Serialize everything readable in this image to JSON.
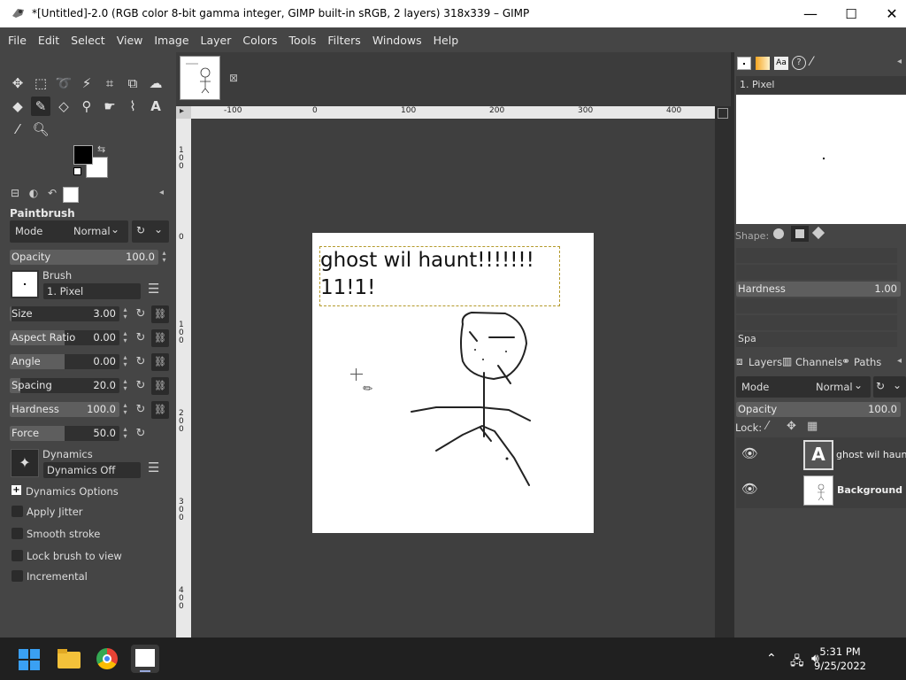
{
  "window": {
    "title": "*[Untitled]-2.0 (RGB color 8-bit gamma integer, GIMP built-in sRGB, 2 layers) 318x339 – GIMP",
    "min": "—",
    "max": "☐",
    "close": "✕"
  },
  "menu": [
    "File",
    "Edit",
    "Select",
    "View",
    "Image",
    "Layer",
    "Colors",
    "Tools",
    "Filters",
    "Windows",
    "Help"
  ],
  "tool_options": {
    "title": "Paintbrush",
    "mode_label": "Mode",
    "mode_value": "Normal",
    "opacity": {
      "label": "Opacity",
      "value": "100.0",
      "fraction": 1.0
    },
    "brush_label": "Brush",
    "brush_name": "1. Pixel",
    "size": {
      "label": "Size",
      "value": "3.00",
      "fraction": 0.0
    },
    "aspect": {
      "label": "Aspect Ratio",
      "value": "0.00",
      "fraction": 0.5
    },
    "angle": {
      "label": "Angle",
      "value": "0.00",
      "fraction": 0.5
    },
    "spacing": {
      "label": "Spacing",
      "value": "20.0",
      "fraction": 0.1
    },
    "hardness": {
      "label": "Hardness",
      "value": "100.0",
      "fraction": 1.0
    },
    "force": {
      "label": "Force",
      "value": "50.0",
      "fraction": 0.5
    },
    "dynamics_label": "Dynamics",
    "dynamics_value": "Dynamics Off",
    "dynamics_options": "Dynamics Options",
    "apply_jitter": "Apply Jitter",
    "smooth_stroke": "Smooth stroke",
    "lock_brush": "Lock brush to view",
    "incremental": "Incremental"
  },
  "rulers": {
    "h": [
      "-100",
      "0",
      "100",
      "200",
      "300",
      "400"
    ],
    "v": [
      "100",
      "0",
      "100",
      "200",
      "300",
      "400"
    ]
  },
  "image_text": {
    "line1": "ghost wil haunt!!!!!!!",
    "line2": "11!1!"
  },
  "brushes_panel": {
    "selected": "1. Pixel",
    "shape_label": "Shape:",
    "hardness_label": "Hardness",
    "hardness_value": "1.00",
    "spacing_partial": "Spa"
  },
  "layers_panel": {
    "tabs": [
      "Layers",
      "Channels",
      "Paths"
    ],
    "mode_label": "Mode",
    "mode_value": "Normal",
    "opacity_label": "Opacity",
    "opacity_value": "100.0",
    "lock_label": "Lock:",
    "layers": [
      {
        "name": "ghost wil haunt!",
        "bold": false
      },
      {
        "name": "Background",
        "bold": true
      }
    ]
  },
  "taskbar": {
    "time": "5:31 PM",
    "date": "9/25/2022"
  },
  "colors": {
    "fg": "#000000",
    "bg": "#ffffff",
    "accent_sel": "#b49a2c"
  }
}
